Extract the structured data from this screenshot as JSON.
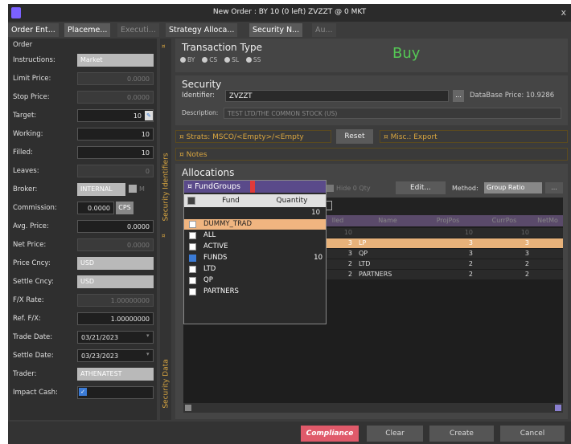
{
  "window": {
    "title": "New Order : BY 10 (0 left) ZVZZT @ 0 MKT",
    "close": "x"
  },
  "tabs": [
    {
      "label": "Order Ent..."
    },
    {
      "label": "Placeme..."
    },
    {
      "label": "Executi..."
    },
    {
      "label": "Strategy Alloca..."
    },
    {
      "label": "Security N..."
    },
    {
      "label": "Au..."
    }
  ],
  "order": {
    "section": "Order",
    "fields": [
      {
        "label": "Instructions:",
        "value": "Market"
      },
      {
        "label": "Limit Price:",
        "value": "0.0000"
      },
      {
        "label": "Stop Price:",
        "value": "0.0000"
      },
      {
        "label": "Target:",
        "value": "10"
      },
      {
        "label": "Working:",
        "value": "10"
      },
      {
        "label": "Filled:",
        "value": "10"
      },
      {
        "label": "Leaves:",
        "value": "0"
      },
      {
        "label": "Broker:",
        "value": "INTERNAL",
        "extra": "M"
      },
      {
        "label": "Commission:",
        "value": "0.0000",
        "extra": "CPS"
      },
      {
        "label": "Avg. Price:",
        "value": "0.0000"
      },
      {
        "label": "Net Price:",
        "value": "0.0000"
      },
      {
        "label": "Price Cncy:",
        "value": "USD"
      },
      {
        "label": "Settle Cncy:",
        "value": "USD"
      },
      {
        "label": "F/X Rate:",
        "value": "1.00000000"
      },
      {
        "label": "Ref. F/X:",
        "value": "1.00000000"
      },
      {
        "label": "Trade Date:",
        "value": "03/21/2023"
      },
      {
        "label": "Settle Date:",
        "value": "03/23/2023"
      },
      {
        "label": "Trader:",
        "value": "ATHENATEST"
      },
      {
        "label": "Impact Cash:",
        "value": ""
      }
    ]
  },
  "side_labels": {
    "ids": "Security Identifiers",
    "data": "Security Data"
  },
  "transaction": {
    "title": "Transaction Type",
    "options": [
      "BY",
      "CS",
      "SL",
      "SS"
    ],
    "side": "Buy"
  },
  "security": {
    "title": "Security",
    "identifier_label": "Identifier:",
    "identifier": "ZVZZT",
    "db_price": "DataBase Price: 10.9286",
    "description_label": "Description:",
    "description": "TEST LTD/THE COMMON STOCK (US)"
  },
  "strats": {
    "label": "¤ Strats: MSCO/<Empty>/<Empty",
    "reset": "Reset",
    "misc": "¤ Misc.: Export"
  },
  "notes": "¤ Notes",
  "allocations": {
    "title": "Allocations",
    "hide_qty": "Hide 0 Qty",
    "edit": "Edit...",
    "method_label": "Method:",
    "method": "Group Ratio",
    "columns": [
      "lled",
      "Name",
      "ProjPos",
      "CurrPos",
      "NetMo"
    ],
    "rows": [
      {
        "a": "10",
        "name": "",
        "proj": "10",
        "curr": "10"
      },
      {
        "a": "3",
        "name": "LP",
        "proj": "3",
        "curr": "3"
      },
      {
        "a": "3",
        "name": "QP",
        "proj": "3",
        "curr": "3"
      },
      {
        "a": "2",
        "name": "LTD",
        "proj": "2",
        "curr": "2"
      },
      {
        "a": "2",
        "name": "PARTNERS",
        "proj": "2",
        "curr": "2"
      }
    ]
  },
  "fundgroups": {
    "title": "¤ FundGroups",
    "col_fund": "Fund",
    "col_qty": "Quantity",
    "total": "10",
    "rows": [
      {
        "fund": "DUMMY_TRAD",
        "qty": "",
        "checked": false
      },
      {
        "fund": "ALL",
        "qty": "",
        "checked": false
      },
      {
        "fund": "ACTIVE",
        "qty": "",
        "checked": false
      },
      {
        "fund": "FUNDS",
        "qty": "10",
        "checked": true
      },
      {
        "fund": "LTD",
        "qty": "",
        "checked": false
      },
      {
        "fund": "QP",
        "qty": "",
        "checked": false
      },
      {
        "fund": "PARTNERS",
        "qty": "",
        "checked": false
      }
    ]
  },
  "buttons": {
    "compliance": "Compliance",
    "clear": "Clear",
    "create": "Create",
    "cancel": "Cancel"
  }
}
